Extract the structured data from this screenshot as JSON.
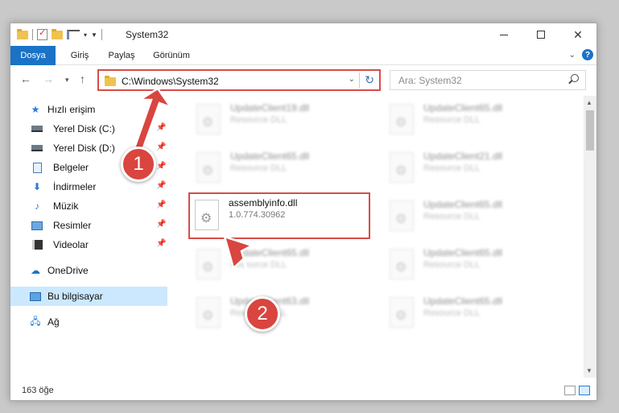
{
  "window": {
    "title": "System32"
  },
  "ribbon": {
    "tabs": [
      "Dosya",
      "Giriş",
      "Paylaş",
      "Görünüm"
    ]
  },
  "address": {
    "path": "C:\\Windows\\System32"
  },
  "search": {
    "placeholder": "Ara: System32"
  },
  "sidebar": {
    "quick_access": "Hızlı erişim",
    "items": [
      {
        "label": "Yerel Disk (C:)",
        "icon": "drive-icon"
      },
      {
        "label": "Yerel Disk (D:)",
        "icon": "drive-icon"
      },
      {
        "label": "Belgeler",
        "icon": "documents-icon"
      },
      {
        "label": "İndirmeler",
        "icon": "downloads-icon"
      },
      {
        "label": "Müzik",
        "icon": "music-icon"
      },
      {
        "label": "Resimler",
        "icon": "pictures-icon"
      },
      {
        "label": "Videolar",
        "icon": "videos-icon"
      }
    ],
    "onedrive": "OneDrive",
    "this_pc": "Bu bilgisayar",
    "network": "Ağ"
  },
  "files": [
    {
      "name": "UpdateClient19.dll",
      "sub": "Resource DLL"
    },
    {
      "name": "UpdateClient65.dll",
      "sub": "Resource DLL"
    },
    {
      "name": "UpdateClient65.dll",
      "sub": "Resource DLL"
    },
    {
      "name": "UpdateClient21.dll",
      "sub": "Resource DLL"
    },
    {
      "name": "assemblyinfo.dll",
      "sub": "1.0.774.30962"
    },
    {
      "name": "UpdateClient65.dll",
      "sub": "Resource DLL"
    },
    {
      "name": "UpdateClient65.dll",
      "sub": "Resource DLL"
    },
    {
      "name": "UpdateClient65.dll",
      "sub": "Resource DLL"
    },
    {
      "name": "UpdateClient63.dll",
      "sub": "Resource DLL"
    },
    {
      "name": "UpdateClient65.dll",
      "sub": "Resource DLL"
    }
  ],
  "status": {
    "count": "163 öğe"
  },
  "annotations": {
    "step1": "1",
    "step2": "2",
    "color": "#d9453f"
  }
}
